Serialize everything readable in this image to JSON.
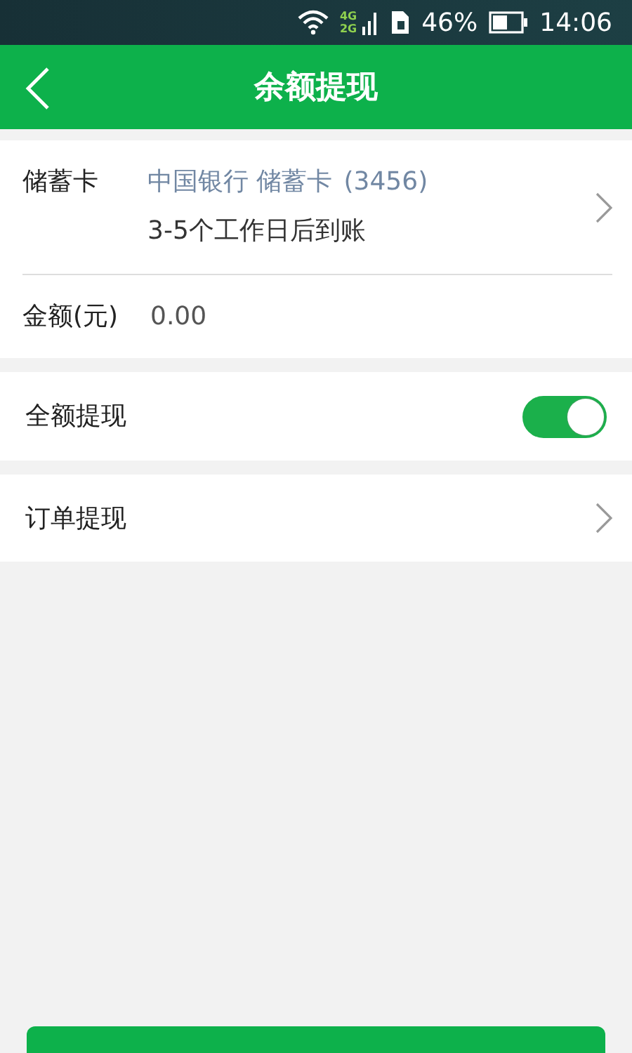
{
  "status_bar": {
    "battery": "46%",
    "time": "14:06",
    "network_top": "4G",
    "network_bottom": "2G"
  },
  "header": {
    "title": "余额提现"
  },
  "card_row": {
    "label": "储蓄卡",
    "account": "中国银行 储蓄卡",
    "number": "(3456)",
    "note": "3-5个工作日后到账"
  },
  "amount_row": {
    "label": "金额(元)",
    "placeholder": "0.00"
  },
  "full_withdraw": {
    "label": "全额提现",
    "on": true
  },
  "order_withdraw": {
    "label": "订单提现"
  }
}
